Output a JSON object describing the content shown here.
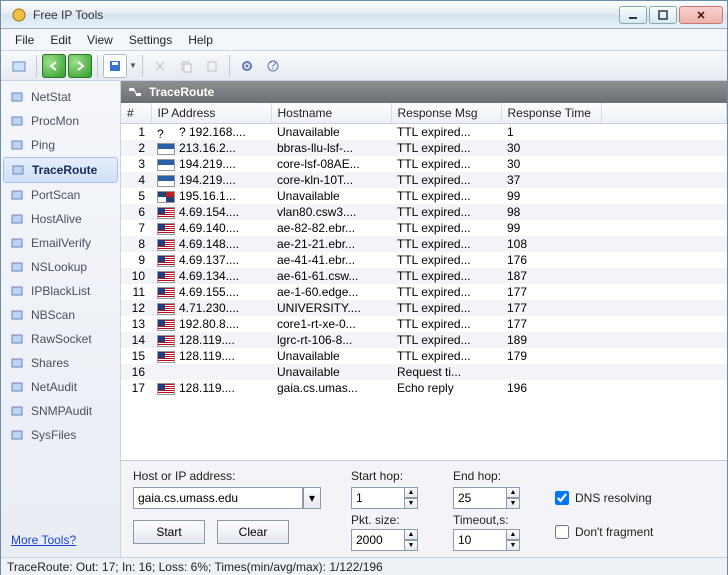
{
  "window": {
    "title": "Free IP Tools"
  },
  "menu": {
    "file": "File",
    "edit": "Edit",
    "view": "View",
    "settings": "Settings",
    "help": "Help"
  },
  "sidebar": {
    "items": [
      {
        "label": "NetStat"
      },
      {
        "label": "ProcMon"
      },
      {
        "label": "Ping"
      },
      {
        "label": "TraceRoute",
        "selected": true
      },
      {
        "label": "PortScan"
      },
      {
        "label": "HostAlive"
      },
      {
        "label": "EmailVerify"
      },
      {
        "label": "NSLookup"
      },
      {
        "label": "IPBlackList"
      },
      {
        "label": "NBScan"
      },
      {
        "label": "RawSocket"
      },
      {
        "label": "Shares"
      },
      {
        "label": "NetAudit"
      },
      {
        "label": "SNMPAudit"
      },
      {
        "label": "SysFiles"
      }
    ],
    "more": "More Tools?"
  },
  "content": {
    "title": "TraceRoute",
    "cols": {
      "n": "#",
      "ip": "IP Address",
      "host": "Hostname",
      "msg": "Response Msg",
      "time": "Response Time"
    },
    "rows": [
      {
        "n": "1",
        "flag": "q",
        "ip": "?  192.168....",
        "host": "Unavailable",
        "msg": "TTL expired...",
        "time": "1"
      },
      {
        "n": "2",
        "flag": "gr",
        "ip": "213.16.2...",
        "host": "bbras-llu-lsf-...",
        "msg": "TTL expired...",
        "time": "30"
      },
      {
        "n": "3",
        "flag": "gr",
        "ip": "194.219....",
        "host": "core-lsf-08AE...",
        "msg": "TTL expired...",
        "time": "30"
      },
      {
        "n": "4",
        "flag": "gr",
        "ip": "194.219....",
        "host": "core-kln-10T...",
        "msg": "TTL expired...",
        "time": "37"
      },
      {
        "n": "5",
        "flag": "uk",
        "ip": "195.16.1...",
        "host": "Unavailable",
        "msg": "TTL expired...",
        "time": "99"
      },
      {
        "n": "6",
        "flag": "us",
        "ip": "4.69.154....",
        "host": "vlan80.csw3....",
        "msg": "TTL expired...",
        "time": "98"
      },
      {
        "n": "7",
        "flag": "us",
        "ip": "4.69.140....",
        "host": "ae-82-82.ebr...",
        "msg": "TTL expired...",
        "time": "99"
      },
      {
        "n": "8",
        "flag": "us",
        "ip": "4.69.148....",
        "host": "ae-21-21.ebr...",
        "msg": "TTL expired...",
        "time": "108"
      },
      {
        "n": "9",
        "flag": "us",
        "ip": "4.69.137....",
        "host": "ae-41-41.ebr...",
        "msg": "TTL expired...",
        "time": "176"
      },
      {
        "n": "10",
        "flag": "us",
        "ip": "4.69.134....",
        "host": "ae-61-61.csw...",
        "msg": "TTL expired...",
        "time": "187"
      },
      {
        "n": "11",
        "flag": "us",
        "ip": "4.69.155....",
        "host": "ae-1-60.edge...",
        "msg": "TTL expired...",
        "time": "177"
      },
      {
        "n": "12",
        "flag": "us",
        "ip": "4.71.230....",
        "host": "UNIVERSITY....",
        "msg": "TTL expired...",
        "time": "177"
      },
      {
        "n": "13",
        "flag": "us",
        "ip": "192.80.8....",
        "host": "core1-rt-xe-0...",
        "msg": "TTL expired...",
        "time": "177"
      },
      {
        "n": "14",
        "flag": "us",
        "ip": "128.119....",
        "host": "lgrc-rt-106-8...",
        "msg": "TTL expired...",
        "time": "189"
      },
      {
        "n": "15",
        "flag": "us",
        "ip": "128.119....",
        "host": "Unavailable",
        "msg": "TTL expired...",
        "time": "179"
      },
      {
        "n": "16",
        "flag": "",
        "ip": "",
        "host": "Unavailable",
        "msg": "Request ti...",
        "time": ""
      },
      {
        "n": "17",
        "flag": "us",
        "ip": "128.119....",
        "host": "gaia.cs.umas...",
        "msg": "Echo reply",
        "time": "196"
      }
    ]
  },
  "form": {
    "host_label": "Host or IP address:",
    "host_value": "gaia.cs.umass.edu",
    "start_hop_label": "Start hop:",
    "start_hop": "1",
    "end_hop_label": "End hop:",
    "end_hop": "25",
    "dns_label": "DNS resolving",
    "dns_checked": true,
    "pkt_label": "Pkt. size:",
    "pkt": "2000",
    "timeout_label": "Timeout,s:",
    "timeout": "10",
    "frag_label": "Don't fragment",
    "frag_checked": false,
    "start_btn": "Start",
    "clear_btn": "Clear"
  },
  "status": "TraceRoute: Out: 17; In: 16; Loss: 6%; Times(min/avg/max): 1/122/196"
}
